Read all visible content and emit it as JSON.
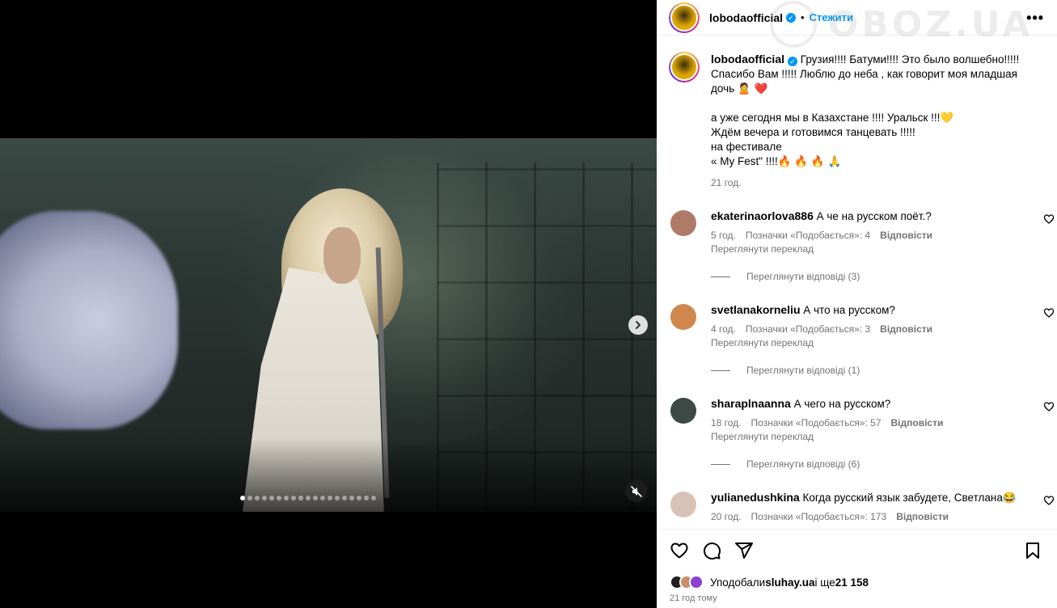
{
  "post": {
    "username": "lobodaofficial",
    "verified_mark": "✓",
    "separator": "•",
    "follow_label": "Стежити",
    "more_label": "•••",
    "caption": "Грузия!!!! Батуми!!!! Это было волшебно!!!!!\nСпасибо Вам !!!!! Люблю до неба , как говорит моя младшая дочь 🙎 ❤️\n\nа уже сегодня мы в Казахстане !!!! Уральск !!!💛\nЖдём вечера и готовимся танцевать !!!!!\nна фестивале\n« My Fest\" !!!!🔥 🔥 🔥 🙏",
    "caption_time": "21 год."
  },
  "carousel": {
    "slide_count": 19,
    "active_index": 0,
    "next_icon": "chevron-right-icon",
    "mute_icon": "muted-speaker-icon"
  },
  "comments": [
    {
      "username": "ekaterinaorlova886",
      "text": "А че на русском поёт.?",
      "time": "5 год.",
      "likes": "Позначки «Подобається»: 4",
      "reply": "Відповісти",
      "translate": "Переглянути переклад",
      "replies": "Переглянути відповіді (3)"
    },
    {
      "username": "svetlanakorneliu",
      "text": "А что на русском?",
      "time": "4 год.",
      "likes": "Позначки «Подобається»: 3",
      "reply": "Відповісти",
      "translate": "Переглянути переклад",
      "replies": "Переглянути відповіді (1)"
    },
    {
      "username": "sharaplnaanna",
      "text": "А чего на русском?",
      "time": "18 год.",
      "likes": "Позначки «Подобається»: 57",
      "reply": "Відповісти",
      "translate": "Переглянути переклад",
      "replies": "Переглянути відповіді (6)"
    },
    {
      "username": "yulianedushkina",
      "text": "Когда русский язык забудете, Светлана😂",
      "time": "20 год.",
      "likes": "Позначки «Подобається»: 173",
      "reply": "Відповісти",
      "translate": "",
      "replies": ""
    }
  ],
  "footer": {
    "likes_prefix": "Уподобали ",
    "likes_user": "sluhay.ua",
    "likes_suffix": " і ще ",
    "likes_count": "21 158",
    "posted": "21 год тому"
  },
  "watermark": {
    "text": "OBOZ.UA"
  },
  "colors": {
    "accent": "#0095f6",
    "muted": "#737373",
    "border": "#efefef"
  }
}
